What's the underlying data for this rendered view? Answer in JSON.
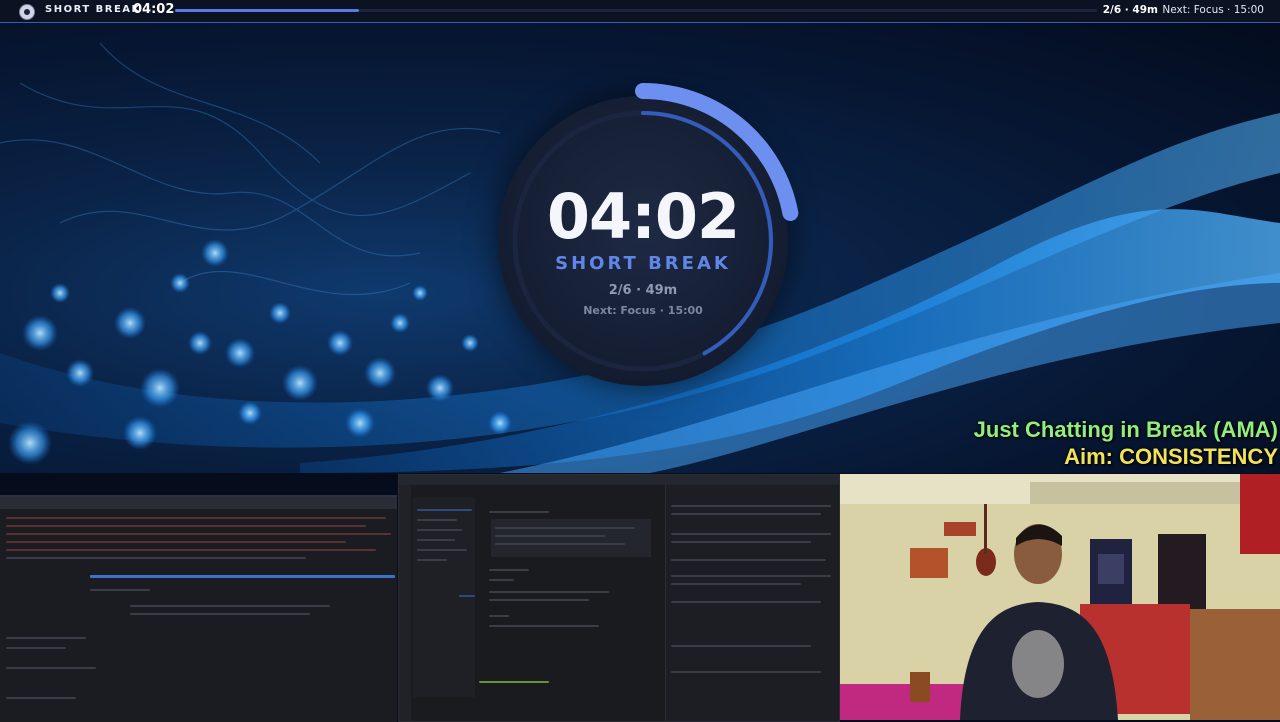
{
  "topbar": {
    "mode": "SHORT BREAK",
    "time": "04:02",
    "progress": 0.2,
    "session": "2/6 · 49m",
    "next": "Next: Focus · 15:00"
  },
  "timer": {
    "time": "04:02",
    "mode": "SHORT BREAK",
    "session": "2/6 · 49m",
    "next": "Next: Focus · 15:00",
    "arc_progress": 0.22,
    "accent": "#5f86e8"
  },
  "overlay": {
    "line1": "Just Chatting in Break (AMA)",
    "line2_label": "Aim: ",
    "line2_value": "CONSISTENCY"
  },
  "colors": {
    "bar_accent": "#5a78e6",
    "overlay_green": "#93ef7d",
    "overlay_yellow": "#f2e25a"
  }
}
